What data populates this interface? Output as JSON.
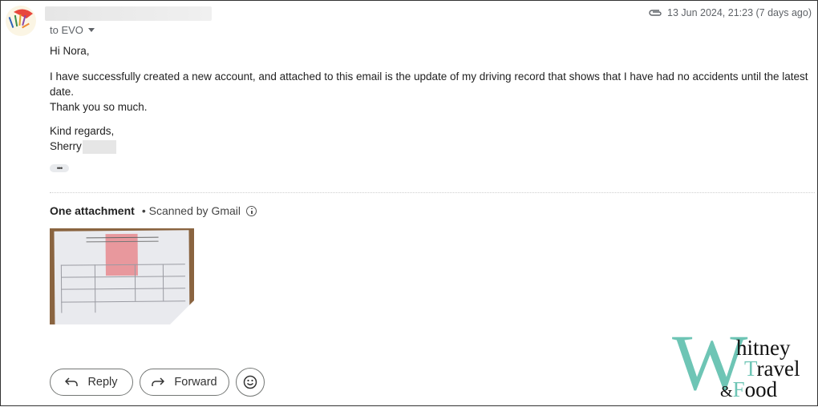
{
  "header": {
    "sender_name": "",
    "recipient_label": "to EVO",
    "timestamp": "13 Jun 2024, 21:23 (7 days ago)",
    "attachment_icon": "paperclip-icon"
  },
  "message": {
    "greeting": "Hi Nora,",
    "paragraph_1": "I have successfully created a new account, and attached to this email is the update of my driving record that shows that I have had no accidents until the latest date.",
    "paragraph_2": "Thank you so much.",
    "closing": "Kind regards,",
    "signature": "Sherry",
    "trimmed_content_label": "•••"
  },
  "attachments": {
    "title": "One attachment",
    "scan_note": "• Scanned by Gmail",
    "items": [
      {
        "type": "image",
        "description": "Scanned driving record certificate"
      }
    ]
  },
  "actions": {
    "reply_label": "Reply",
    "forward_label": "Forward",
    "emoji_icon": "smiley-icon"
  },
  "watermark": {
    "letter": "W",
    "line1": "hitney",
    "line2_initial": "T",
    "line2": "ravel",
    "line3_amp": "&",
    "line3_initial": "F",
    "line3": "ood",
    "accent_color": "#6ec5b5"
  }
}
